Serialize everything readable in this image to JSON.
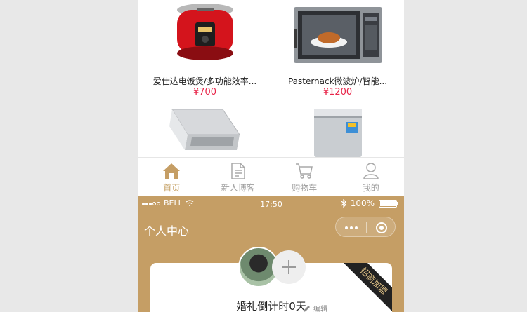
{
  "products": [
    {
      "name": "爱仕达电饭煲/多功能效率...",
      "price": "¥700",
      "image": "rice-cooker"
    },
    {
      "name": "Pasternack微波炉/智能...",
      "price": "¥1200",
      "image": "microwave"
    },
    {
      "name": "",
      "price": "",
      "image": "laptop"
    },
    {
      "name": "",
      "price": "",
      "image": "washing-machine"
    }
  ],
  "tabbar": {
    "items": [
      {
        "label": "首页",
        "icon": "home-icon",
        "active": true
      },
      {
        "label": "新人博客",
        "icon": "document-icon",
        "active": false
      },
      {
        "label": "购物车",
        "icon": "cart-icon",
        "active": false
      },
      {
        "label": "我的",
        "icon": "user-icon",
        "active": false
      }
    ]
  },
  "statusbar": {
    "carrier": "BELL",
    "time": "17:50",
    "battery": "100%"
  },
  "nav": {
    "title": "个人中心"
  },
  "profile": {
    "ribbon": "招商加盟",
    "countdown": "婚礼倒计时0天",
    "edit_label": "编辑"
  },
  "colors": {
    "accent": "#c59e65",
    "price": "#e8264a",
    "tab_inactive": "#a0a0a0"
  }
}
